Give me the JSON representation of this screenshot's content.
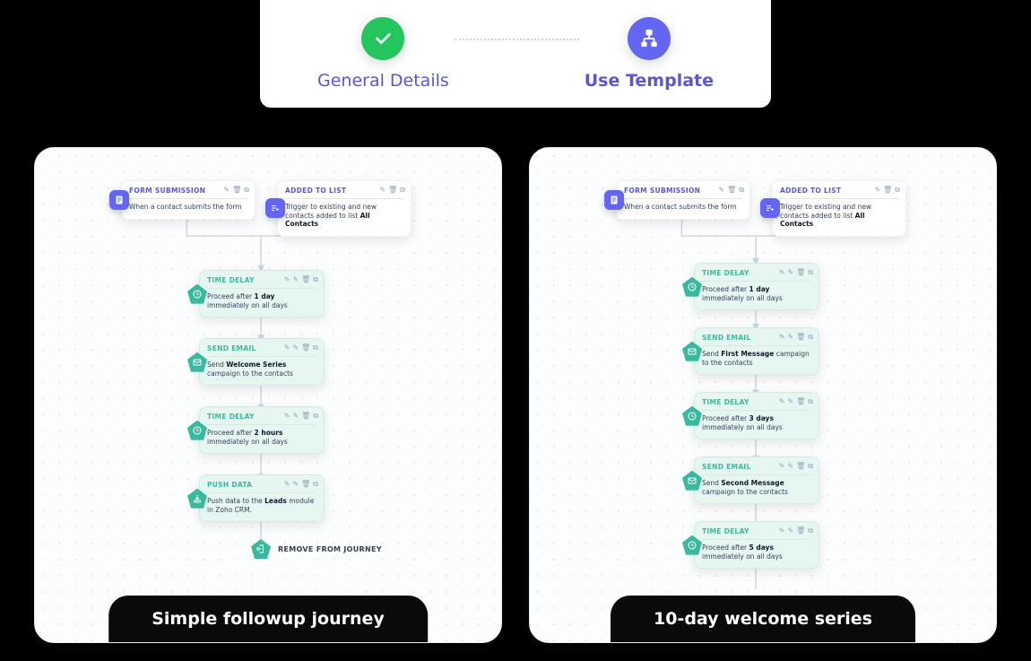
{
  "stepper": {
    "steps": [
      {
        "label": "General Details",
        "state": "done"
      },
      {
        "label": "Use Template",
        "state": "active"
      }
    ]
  },
  "templates": [
    {
      "title": "Simple followup  journey",
      "triggers": [
        {
          "type": "FORM SUBMISSION",
          "text": "When a contact submits the form"
        },
        {
          "type": "ADDED TO LIST",
          "text_before": "Trigger to existing and new contacts added to list ",
          "text_strong": "All Contacts"
        }
      ],
      "flow": [
        {
          "kind": "delay",
          "title": "TIME DELAY",
          "text_before": "Proceed after ",
          "text_strong": "1 day",
          "text_after": " immediately on all days"
        },
        {
          "kind": "email",
          "title": "SEND EMAIL",
          "text_before": "Send ",
          "text_strong": "Welcome Series",
          "text_after": " campaign to the contacts"
        },
        {
          "kind": "delay",
          "title": "TIME DELAY",
          "text_before": "Proceed after ",
          "text_strong": "2 hours",
          "text_after": " immediately on all days"
        },
        {
          "kind": "push",
          "title": "PUSH DATA",
          "text_before": "Push data to the ",
          "text_strong": "Leads",
          "text_after": " module in Zoho CRM."
        }
      ],
      "terminal": "REMOVE FROM JOURNEY"
    },
    {
      "title": "10-day welcome series",
      "triggers": [
        {
          "type": "FORM SUBMISSION",
          "text": "When a contact submits the form"
        },
        {
          "type": "ADDED TO LIST",
          "text_before": "Trigger to existing and new contacts added to list ",
          "text_strong": "All Contacts"
        }
      ],
      "flow": [
        {
          "kind": "delay",
          "title": "TIME DELAY",
          "text_before": "Proceed after ",
          "text_strong": "1 day",
          "text_after": " immediately on all days"
        },
        {
          "kind": "email",
          "title": "SEND EMAIL",
          "text_before": "Send ",
          "text_strong": "First Message",
          "text_after": " campaign to the contacts"
        },
        {
          "kind": "delay",
          "title": "TIME DELAY",
          "text_before": "Proceed after ",
          "text_strong": "3 days",
          "text_after": " immediately on all days"
        },
        {
          "kind": "email",
          "title": "SEND EMAIL",
          "text_before": "Send ",
          "text_strong": "Second Message",
          "text_after": " campaign to the contacts"
        },
        {
          "kind": "delay",
          "title": "TIME DELAY",
          "text_before": "Proceed after ",
          "text_strong": "5 days",
          "text_after": " immediately on all days"
        }
      ]
    }
  ],
  "node_tools": [
    "edit",
    "copy",
    "delete"
  ],
  "colors": {
    "purple": "#6366f1",
    "green": "#22c55e",
    "teal": "#3bb99f"
  }
}
